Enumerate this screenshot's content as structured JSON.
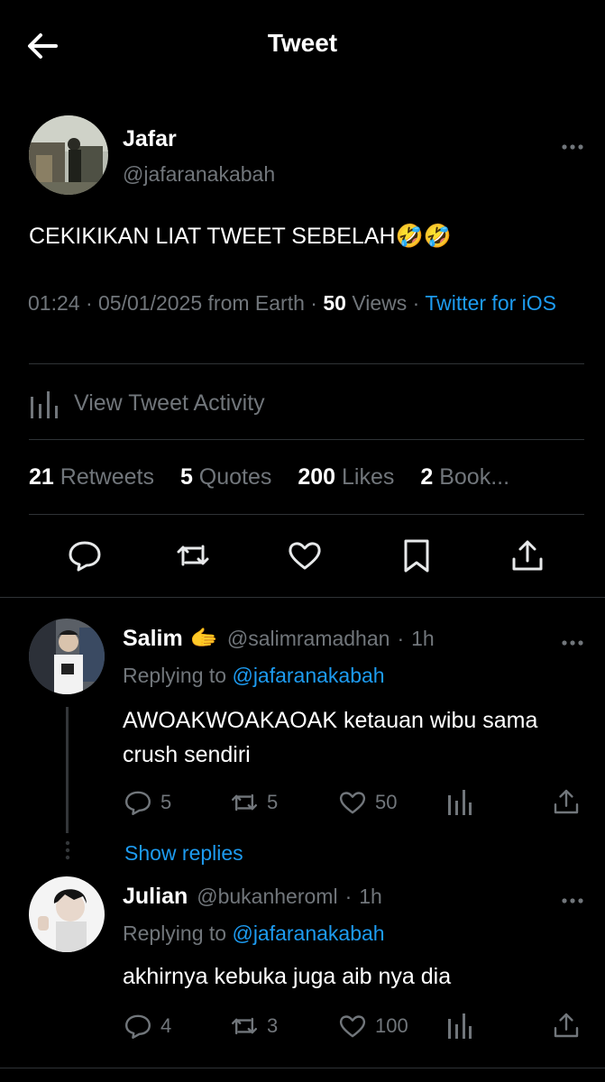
{
  "header": {
    "title": "Tweet"
  },
  "tweet": {
    "author_name": "Jafar",
    "author_handle": "@jafaranakabah",
    "text": "CEKIKIKAN LIAT TWEET SEBELAH",
    "emoji": "🤣🤣",
    "time": "01:24",
    "date": "05/01/2025",
    "location": "from Earth",
    "views_count": "50",
    "views_label": "Views",
    "client": "Twitter for iOS",
    "activity_label": "View Tweet Activity",
    "retweets_count": "21",
    "retweets_label": "Retweets",
    "quotes_count": "5",
    "quotes_label": "Quotes",
    "likes_count": "200",
    "likes_label": "Likes",
    "bookmarks_count": "2",
    "bookmarks_label": "Book..."
  },
  "replies": [
    {
      "name": "Salim",
      "name_emoji": "🫱",
      "handle": "@salimramadhan",
      "time": "1h",
      "replying_prefix": "Replying to",
      "replying_handle": "@jafaranakabah",
      "text": "AWOAKWOAKAOAK ketauan wibu sama crush sendiri",
      "reply_count": "5",
      "retweet_count": "5",
      "like_count": "50",
      "show_replies": "Show replies"
    },
    {
      "name": "Julian",
      "handle": "@bukanheroml",
      "time": "1h",
      "replying_prefix": "Replying to",
      "replying_handle": "@jafaranakabah",
      "text": "akhirnya kebuka juga aib nya dia",
      "reply_count": "4",
      "retweet_count": "3",
      "like_count": "100"
    }
  ],
  "colors": {
    "background": "#000000",
    "accent": "#1d9bf0",
    "muted": "#71767b",
    "divider": "#2f3336"
  }
}
